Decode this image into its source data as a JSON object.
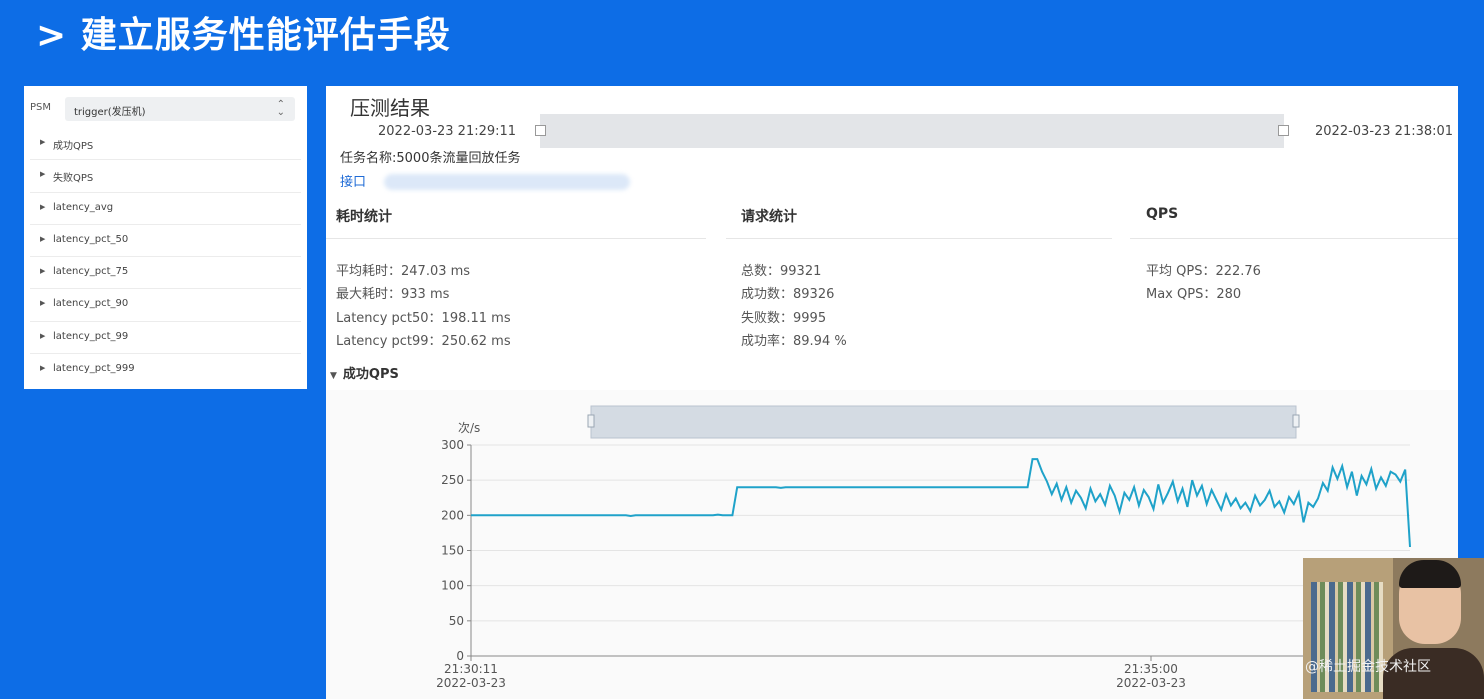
{
  "slide_title": "> 建立服务性能评估手段",
  "left_panel": {
    "psm_label": "PSM",
    "psm_value": "trigger(发压机)",
    "items": [
      {
        "label": "成功QPS"
      },
      {
        "label": "失败QPS"
      },
      {
        "label": "latency_avg"
      },
      {
        "label": "latency_pct_50"
      },
      {
        "label": "latency_pct_75"
      },
      {
        "label": "latency_pct_90"
      },
      {
        "label": "latency_pct_99"
      },
      {
        "label": "latency_pct_999"
      }
    ]
  },
  "result": {
    "title": "压测结果",
    "start_time": "2022-03-23 21:29:11",
    "end_time": "2022-03-23 21:38:01",
    "task_name": "任务名称:5000条流量回放任务",
    "interface_label": "接口"
  },
  "sections": {
    "latency": {
      "title": "耗时统计",
      "stats": [
        "平均耗时：247.03 ms",
        "最大耗时：933 ms",
        "Latency pct50：198.11 ms",
        "Latency pct99：250.62 ms"
      ]
    },
    "requests": {
      "title": "请求统计",
      "stats": [
        "总数：99321",
        "成功数：89326",
        "失败数：9995",
        "成功率：89.94 %"
      ]
    },
    "qps": {
      "title": "QPS",
      "stats": [
        "平均 QPS：222.76",
        "Max QPS：280"
      ]
    }
  },
  "qps_toggle_label": "成功QPS",
  "chart_data": {
    "type": "line",
    "ylabel": "次/s",
    "ylim": [
      0,
      300
    ],
    "yticks": [
      0,
      50,
      100,
      150,
      200,
      250,
      300
    ],
    "xticks": [
      {
        "time": "21:30:11",
        "date": "2022-03-23"
      },
      {
        "time": "21:35:00",
        "date": "2022-03-23"
      }
    ],
    "line_color": "#1fa2c9",
    "series": [
      {
        "values": [
          200,
          200,
          200,
          200,
          200,
          200,
          200,
          200,
          200,
          200,
          200,
          200,
          200,
          200,
          200,
          200,
          200,
          200,
          200,
          200,
          200,
          200,
          200,
          200,
          200,
          200,
          200,
          200,
          200,
          200,
          200,
          200,
          200,
          199,
          200,
          200,
          200,
          200,
          200,
          200,
          200,
          200,
          200,
          200,
          200,
          200,
          200,
          200,
          200,
          200,
          200,
          201,
          200,
          200,
          200,
          240,
          240,
          240,
          240,
          240,
          240,
          240,
          240,
          240,
          239,
          240,
          240,
          240,
          240,
          240,
          240,
          240,
          240,
          240,
          240,
          240,
          240,
          240,
          240,
          240,
          240,
          240,
          240,
          240,
          240,
          240,
          240,
          240,
          240,
          240,
          240,
          240,
          240,
          240,
          240,
          240,
          240,
          240,
          240,
          240,
          240,
          240,
          240,
          240,
          240,
          240,
          240,
          240,
          240,
          240,
          240,
          240,
          240,
          240,
          240,
          240,
          280,
          280,
          262,
          248,
          230,
          245,
          222,
          240,
          218,
          235,
          225,
          210,
          238,
          220,
          230,
          215,
          242,
          228,
          205,
          232,
          222,
          240,
          214,
          236,
          226,
          209,
          244,
          218,
          232,
          248,
          220,
          238,
          212,
          250,
          228,
          242,
          216,
          236,
          222,
          208,
          230,
          214,
          224,
          210,
          218,
          206,
          228,
          214,
          222,
          235,
          212,
          220,
          204,
          226,
          216,
          232,
          190,
          218,
          212,
          224,
          246,
          235,
          268,
          252,
          270,
          240,
          262,
          228,
          256,
          244,
          266,
          238,
          254,
          242,
          262,
          258,
          248,
          265,
          155
        ]
      }
    ]
  }
}
